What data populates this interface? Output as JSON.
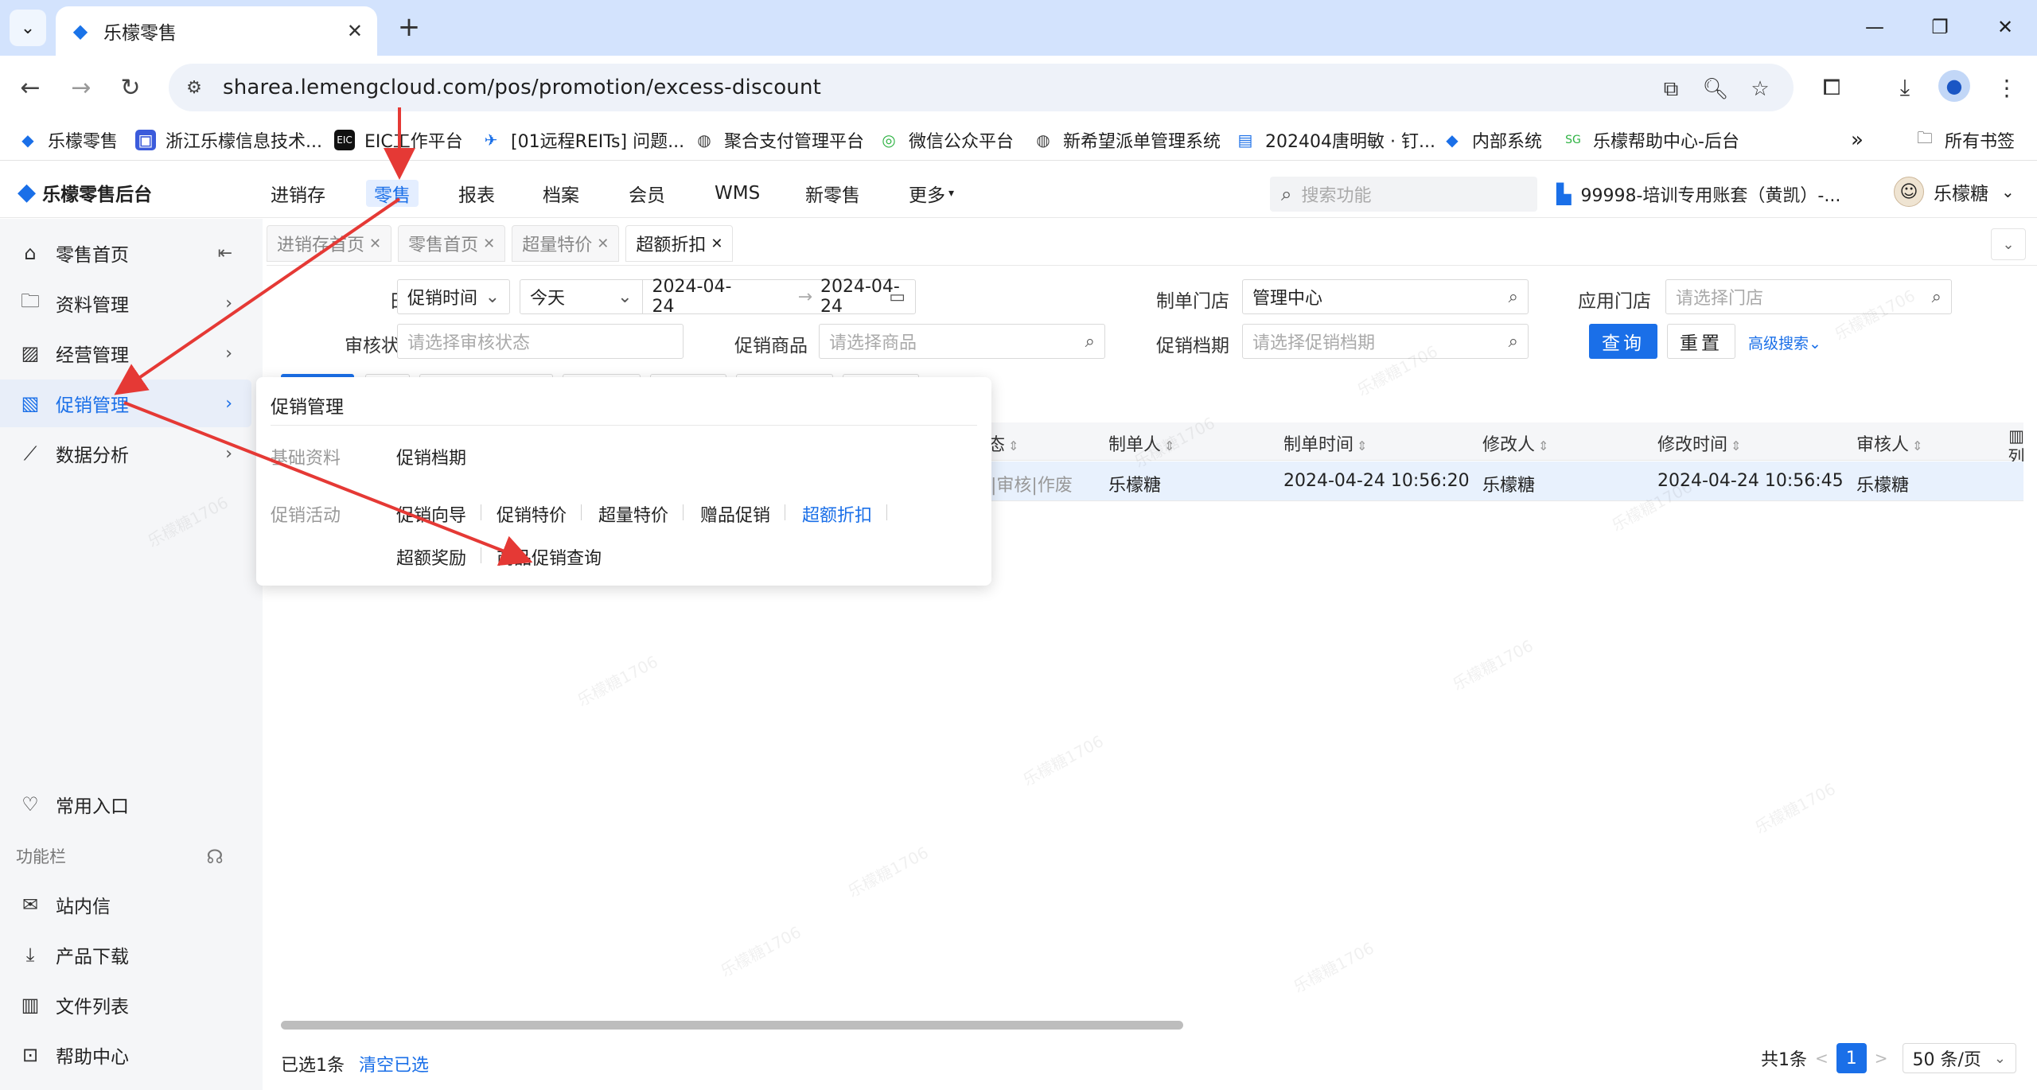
{
  "browser": {
    "tab_title": "乐檬零售",
    "url": "sharea.lemengcloud.com/pos/promotion/excess-discount",
    "bookmarks": [
      "乐檬零售",
      "浙江乐檬信息技术...",
      "EIC工作平台",
      "[01远程REITs] 问题...",
      "聚合支付管理平台",
      "微信公众平台",
      "新希望派单管理系统",
      "202404唐明敏 · 钉...",
      "内部系统",
      "乐檬帮助中心-后台"
    ],
    "all_bookmarks": "所有书签",
    "bookmark_more": "»"
  },
  "header": {
    "logo_text": "乐檬零售后台",
    "nav": [
      "进销存",
      "零售",
      "报表",
      "档案",
      "会员",
      "WMS",
      "新零售",
      "更多"
    ],
    "active_nav": "零售",
    "search_placeholder": "搜索功能",
    "account": "99998-培训专用账套（黄凯）-...",
    "user": "乐檬糖"
  },
  "sidebar": {
    "items": [
      "零售首页",
      "资料管理",
      "经营管理",
      "促销管理",
      "数据分析"
    ],
    "common_entry": "常用入口",
    "func_bar_label": "功能栏",
    "bottom_items": [
      "站内信",
      "产品下载",
      "文件列表",
      "帮助中心"
    ]
  },
  "page_tabs": [
    {
      "label": "进销存首页",
      "active": false
    },
    {
      "label": "零售首页",
      "active": false
    },
    {
      "label": "超量特价",
      "active": false
    },
    {
      "label": "超额折扣",
      "active": true
    }
  ],
  "filters": {
    "date_label": "日期",
    "date_type": "促销时间",
    "date_range_preset": "今天",
    "date_start": "2024-04-24",
    "date_sep": "→",
    "date_end": "2024-04-24",
    "store_label": "制单门店",
    "store_value": "管理中心",
    "apply_store_label": "应用门店",
    "apply_store_placeholder": "请选择门店",
    "audit_label": "审核状态",
    "audit_placeholder": "请选择审核状态",
    "product_label": "促销商品",
    "product_placeholder": "请选择商品",
    "period_label": "促销档期",
    "period_placeholder": "请选择促销档期",
    "query_btn": "查询",
    "reset_btn": "重置",
    "advanced": "高级搜索"
  },
  "table": {
    "headers": [
      "态",
      "制单人",
      "制单时间",
      "修改人",
      "修改时间",
      "审核人"
    ],
    "row": [
      "单|审核|作废",
      "乐檬糖",
      "2024-04-24 10:56:20",
      "乐檬糖",
      "2024-04-24 10:56:45",
      "乐檬糖"
    ],
    "col_setting": "列"
  },
  "footer": {
    "selected": "已选1条",
    "clear": "清空已选",
    "total": "共1条",
    "prev": "<",
    "page": "1",
    "next": ">",
    "page_size": "50 条/页"
  },
  "flyout": {
    "title": "促销管理",
    "basic_label": "基础资料",
    "basic_items": [
      "促销档期"
    ],
    "activity_label": "促销活动",
    "activity_items": [
      "促销向导",
      "促销特价",
      "超量特价",
      "赠品促销",
      "超额折扣",
      "超额奖励",
      "商品促销查询"
    ],
    "active_item": "超额折扣"
  },
  "watermark": "乐檬糖1706",
  "colors": {
    "accent": "#1a6fe8",
    "annotation_arrow": "#e53935"
  }
}
